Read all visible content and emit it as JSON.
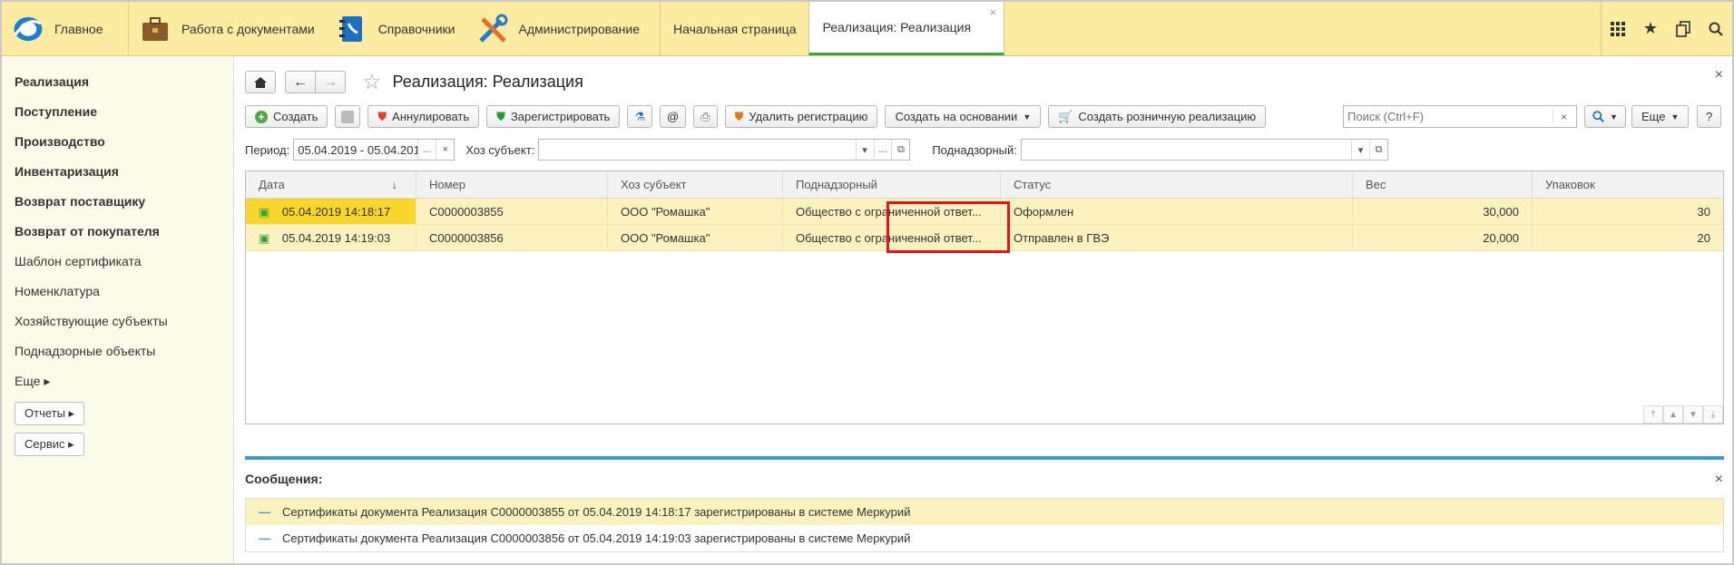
{
  "topbar": {
    "home_label": "Главное",
    "sections": [
      {
        "label": "Работа с документами",
        "icon": "briefcase-icon"
      },
      {
        "label": "Справочники",
        "icon": "phonebook-icon"
      },
      {
        "label": "Администрирование",
        "icon": "tools-icon"
      }
    ],
    "tabs": [
      {
        "label": "Начальная страница"
      },
      {
        "label": "Реализация: Реализация",
        "close": "×"
      }
    ],
    "right_icons": [
      "grid-icon",
      "star-icon",
      "copy-icon",
      "search-icon"
    ]
  },
  "sidebar": {
    "items": [
      {
        "label": "Реализация",
        "bold": true
      },
      {
        "label": "Поступление",
        "bold": true
      },
      {
        "label": "Производство",
        "bold": true
      },
      {
        "label": "Инвентаризация",
        "bold": true
      },
      {
        "label": "Возврат поставщику",
        "bold": true
      },
      {
        "label": "Возврат от покупателя",
        "bold": true
      },
      {
        "label": "Шаблон сертификата",
        "bold": false
      },
      {
        "label": "Номенклатура",
        "bold": false
      },
      {
        "label": "Хозяйствующие субъекты",
        "bold": false
      },
      {
        "label": "Поднадзорные объекты",
        "bold": false
      },
      {
        "label": "Еще ▸",
        "bold": false
      }
    ],
    "buttons": [
      {
        "label": "Отчеты ▸"
      },
      {
        "label": "Сервис ▸"
      }
    ]
  },
  "page": {
    "title": "Реализация: Реализация",
    "close": "×"
  },
  "toolbar": {
    "create": "Создать",
    "annul": "Аннулировать",
    "register": "Зарегистрировать",
    "at": "@",
    "delete_reg": "Удалить регистрацию",
    "create_based": "Создать на основании",
    "create_retail": "Создать розничную реализацию",
    "search_placeholder": "Поиск (Ctrl+F)",
    "search_clear": "×",
    "more": "Еще",
    "help": "?"
  },
  "filters": {
    "period_label": "Период:",
    "period_value": "05.04.2019 - 05.04.201",
    "subject_label": "Хоз субъект:",
    "subject_value": "",
    "supervised_label": "Поднадзорный:",
    "supervised_value": ""
  },
  "table": {
    "headers": [
      "Дата",
      "Номер",
      "Хоз субъект",
      "Поднадзорный",
      "Статус",
      "Вес",
      "Упаковок"
    ],
    "sort_arrow": "↓",
    "rows": [
      {
        "date": "05.04.2019 14:18:17",
        "number": "С0000003855",
        "subject": "ООО \"Ромашка\"",
        "supervised": "Общество с ограниченной ответ...",
        "status": "Оформлен",
        "weight": "30,000",
        "packages": "30"
      },
      {
        "date": "05.04.2019 14:19:03",
        "number": "С0000003856",
        "subject": "ООО \"Ромашка\"",
        "supervised": "Общество с ограниченной ответ...",
        "status": "Отправлен в ГВЭ",
        "weight": "20,000",
        "packages": "20"
      }
    ]
  },
  "messages": {
    "title": "Сообщения:",
    "close": "×",
    "items": [
      "Сертификаты документа Реализация С0000003855 от 05.04.2019 14:18:17 зарегистрированы в системе Меркурий",
      "Сертификаты документа Реализация С0000003856 от 05.04.2019 14:19:03 зарегистрированы в системе Меркурий"
    ]
  },
  "colors": {
    "topbar_bg": "#fbeca2",
    "row_bg": "#fbf2c0",
    "row_selected": "#f9d62b",
    "highlight_box": "#e3141b",
    "message_bar": "#3d9ad7"
  }
}
